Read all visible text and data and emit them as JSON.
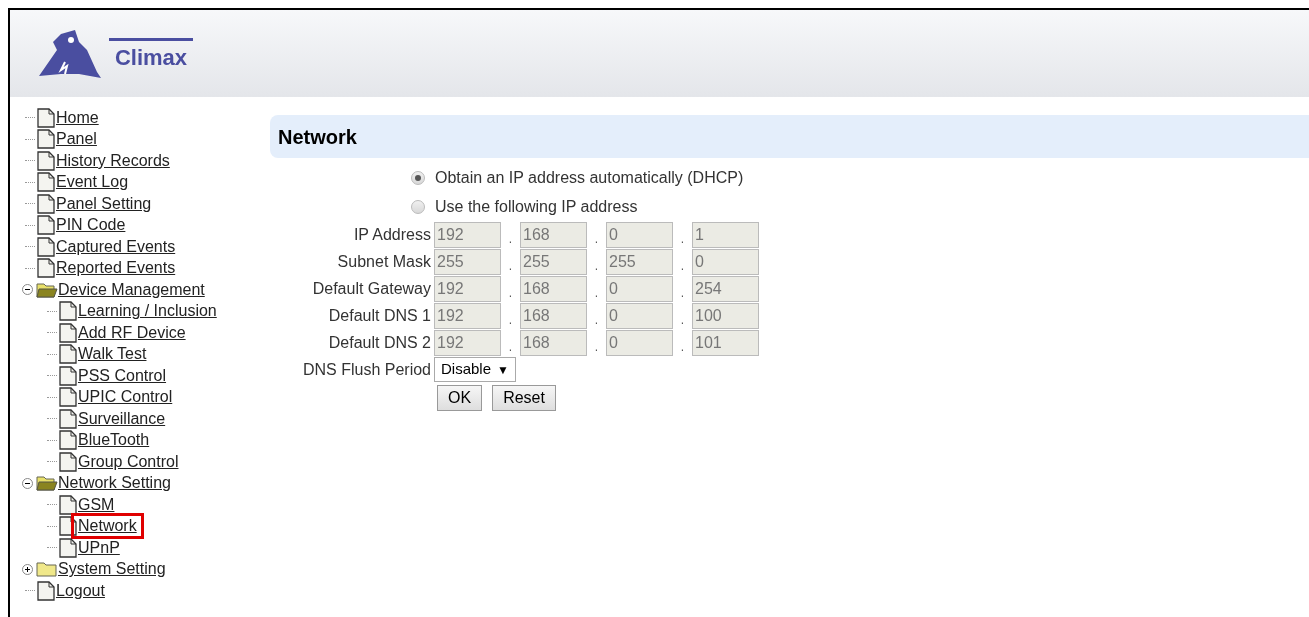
{
  "header": {
    "logo_text": "Climax"
  },
  "tree": [
    {
      "label": "Home",
      "kind": "page",
      "highlighted": false
    },
    {
      "label": "Panel",
      "kind": "page",
      "highlighted": false
    },
    {
      "label": "History Records",
      "kind": "page",
      "highlighted": false
    },
    {
      "label": "Event Log",
      "kind": "page",
      "highlighted": false
    },
    {
      "label": "Panel Setting",
      "kind": "page",
      "highlighted": false
    },
    {
      "label": "PIN Code",
      "kind": "page",
      "highlighted": false
    },
    {
      "label": "Captured Events",
      "kind": "page",
      "highlighted": false
    },
    {
      "label": "Reported Events",
      "kind": "page",
      "highlighted": false
    },
    {
      "label": "Device Management",
      "kind": "folder",
      "expanded": true,
      "highlighted": false,
      "children": [
        {
          "label": "Learning / Inclusion",
          "kind": "page",
          "highlighted": false
        },
        {
          "label": "Add RF Device",
          "kind": "page",
          "highlighted": false
        },
        {
          "label": "Walk Test",
          "kind": "page",
          "highlighted": false
        },
        {
          "label": "PSS Control",
          "kind": "page",
          "highlighted": false
        },
        {
          "label": "UPIC Control",
          "kind": "page",
          "highlighted": false
        },
        {
          "label": "Surveillance",
          "kind": "page",
          "highlighted": false
        },
        {
          "label": "BlueTooth",
          "kind": "page",
          "highlighted": false
        },
        {
          "label": "Group Control",
          "kind": "page",
          "highlighted": false
        }
      ]
    },
    {
      "label": "Network Setting",
      "kind": "folder",
      "expanded": true,
      "highlighted": false,
      "children": [
        {
          "label": "GSM",
          "kind": "page",
          "highlighted": false
        },
        {
          "label": "Network",
          "kind": "page",
          "highlighted": true
        },
        {
          "label": "UPnP",
          "kind": "page",
          "highlighted": false
        }
      ]
    },
    {
      "label": "System Setting",
      "kind": "folder",
      "expanded": false,
      "highlighted": false
    },
    {
      "label": "Logout",
      "kind": "page",
      "highlighted": false
    }
  ],
  "section_title": "Network",
  "ip_mode": [
    {
      "label": "Obtain an IP address automatically (DHCP)",
      "selected": true
    },
    {
      "label": "Use the following IP address",
      "selected": false
    }
  ],
  "address_rows": [
    {
      "label": "IP Address",
      "disabled": true,
      "octets": [
        "192",
        "168",
        "0",
        "1"
      ]
    },
    {
      "label": "Subnet Mask",
      "disabled": true,
      "octets": [
        "255",
        "255",
        "255",
        "0"
      ]
    },
    {
      "label": "Default Gateway",
      "disabled": true,
      "octets": [
        "192",
        "168",
        "0",
        "254"
      ]
    },
    {
      "label": "Default DNS 1",
      "disabled": true,
      "octets": [
        "192",
        "168",
        "0",
        "100"
      ]
    },
    {
      "label": "Default DNS 2",
      "disabled": true,
      "octets": [
        "192",
        "168",
        "0",
        "101"
      ]
    }
  ],
  "separator": ".",
  "dns_flush": {
    "label": "DNS Flush Period",
    "value": "Disable",
    "caret": "▼"
  },
  "buttons": [
    "OK",
    "Reset"
  ]
}
